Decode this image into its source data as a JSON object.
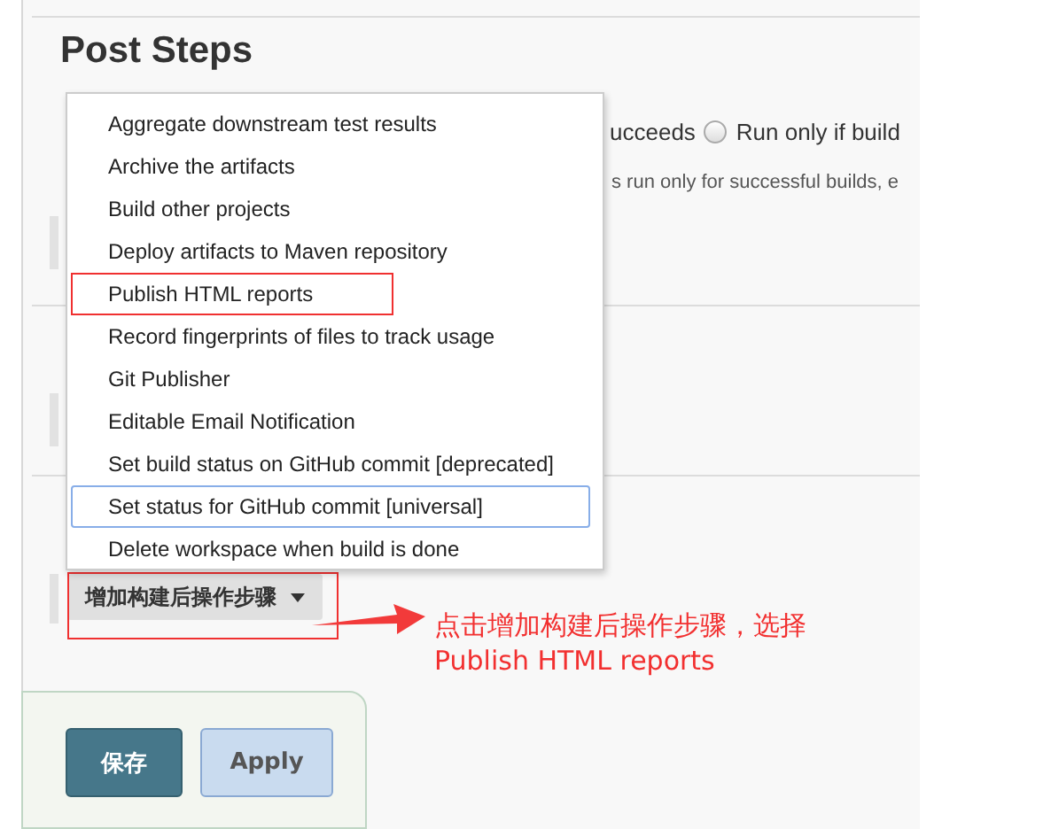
{
  "section": {
    "title": "Post Steps"
  },
  "run_condition": {
    "option_fragment": "ucceeds",
    "option_label": "Run only if build",
    "option_checked": false,
    "help_fragment": "s run only for successful builds, e"
  },
  "menu": {
    "items": [
      {
        "label": "Aggregate downstream test results",
        "focused": false,
        "marked": false
      },
      {
        "label": "Archive the artifacts",
        "focused": false,
        "marked": false
      },
      {
        "label": "Build other projects",
        "focused": false,
        "marked": false
      },
      {
        "label": "Deploy artifacts to Maven repository",
        "focused": false,
        "marked": false
      },
      {
        "label": "Publish HTML reports",
        "focused": false,
        "marked": true
      },
      {
        "label": "Record fingerprints of files to track usage",
        "focused": false,
        "marked": false
      },
      {
        "label": "Git Publisher",
        "focused": false,
        "marked": false
      },
      {
        "label": "Editable Email Notification",
        "focused": false,
        "marked": false
      },
      {
        "label": "Set build status on GitHub commit [deprecated]",
        "focused": false,
        "marked": false
      },
      {
        "label": "Set status for GitHub commit [universal]",
        "focused": true,
        "marked": false
      },
      {
        "label": "Delete workspace when build is done",
        "focused": false,
        "marked": false
      }
    ]
  },
  "add_button": {
    "label": "增加构建后操作步骤",
    "marked": true
  },
  "annotation": {
    "lines": [
      "点击增加构建后操作步骤，选择",
      "Publish HTML reports"
    ]
  },
  "buttons": [
    {
      "label": "保存",
      "kind": "primary"
    },
    {
      "label": "Apply",
      "kind": "secondary"
    }
  ]
}
